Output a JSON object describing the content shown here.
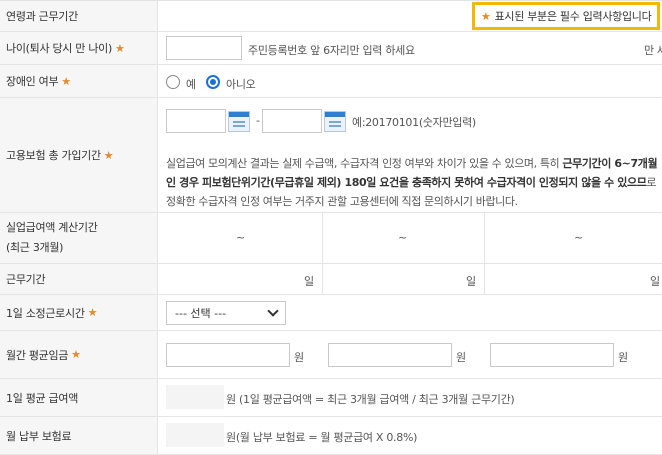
{
  "header": {
    "label": "연령과 근무기간",
    "notice_star": "★",
    "notice_text": "표시된 부분은 필수 입력사항입니다"
  },
  "required_mark": "★",
  "age": {
    "label": "나이(퇴사 당시 만 나이)",
    "hint": "주민등록번호 앞 6자리만 입력 하세요",
    "unit": "만 세"
  },
  "disability": {
    "label": "장애인 여부",
    "options": [
      "예",
      "아니오"
    ],
    "selected": "아니오"
  },
  "insurance_period": {
    "label": "고용보험 총 가입기간",
    "separator": "-",
    "date_hint": "예:20170101(숫자만입력)",
    "desc_part1": "실업급여 모의계산 결과는 실제 수급액, 수급자격 인정 여부와 차이가 있을 수 있으며, 특히 ",
    "desc_bold": "근무기간이 6~7개월인 경우 피보험단위기간(무급휴일 제외) 180일 요건을 충족하지 못하여 수급자격이 인정되지 않을 수 있으므",
    "desc_part2": "로 정확한 수급자격 인정 여부는 거주지 관할 고용센터에 직접 문의하시기 바랍니다."
  },
  "calc_period": {
    "label_line1": "실업급여액 계산기간",
    "label_line2": "(최근 3개월)",
    "tilde": "~"
  },
  "work_days": {
    "label": "근무기간",
    "unit": "일"
  },
  "daily_hours": {
    "label": "1일 소정근로시간",
    "select_value": "--- 선택 ---"
  },
  "monthly_wage": {
    "label": "월간 평균임금",
    "unit": "원"
  },
  "daily_benefit": {
    "label": "1일 평균 급여액",
    "formula": "원 (1일 평균급여액 = 최근 3개월 급여액 / 최근 3개월 근무기간)"
  },
  "monthly_premium": {
    "label": "월 납부 보험료",
    "formula": "원(월 납부 보험료 = 월 평균급여 X 0.8%)"
  }
}
